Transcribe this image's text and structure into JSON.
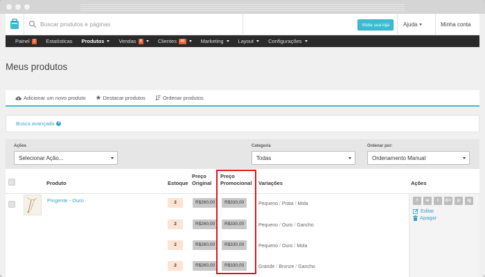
{
  "search": {
    "placeholder": "Buscar produtos e páginas"
  },
  "topbar": {
    "visit_label": "Visite sua loja",
    "help_label": "Ajuda",
    "account_label": "Minha conta"
  },
  "nav": {
    "painel": "Painel",
    "painel_badge": "2",
    "estatisticas": "Estatísticas",
    "produtos": "Produtos",
    "vendas": "Vendas",
    "vendas_badge": "8",
    "clientes": "Clientes",
    "clientes_badge": "45",
    "marketing": "Marketing",
    "layout": "Layout",
    "configuracoes": "Configurações"
  },
  "page": {
    "title": "Meus produtos"
  },
  "actions": {
    "add": "Adicionar um novo produto",
    "highlight": "Destacar produtos",
    "order": "Ordenar produtos"
  },
  "advanced_search": "Busca avançada",
  "filters": {
    "acoes_label": "Ações",
    "acoes_value": "Selecionar Ação...",
    "categoria_label": "Categoria",
    "categoria_value": "Todas",
    "ordenar_label": "Ordenar por:",
    "ordenar_value": "Ordenamento Manual"
  },
  "table": {
    "headers": {
      "produto": "Produto",
      "estoque": "Estoque",
      "preco_original_1": "Preço",
      "preco_original_2": "Original",
      "preco_promo_1": "Preço",
      "preco_promo_2": "Promocional",
      "variacoes": "Variações",
      "acoes": "Ações"
    },
    "product_name": "Pingente - Ouro",
    "rows": [
      {
        "estoque": "2",
        "original": "R$260,00",
        "promo": "R$330,00",
        "v1": "Pequeno",
        "v2": "Prata",
        "v3": "Mola"
      },
      {
        "estoque": "2",
        "original": "R$260,00",
        "promo": "R$330,00",
        "v1": "Pequeno",
        "v2": "Ouro",
        "v3": "Gancho"
      },
      {
        "estoque": "2",
        "original": "R$260,00",
        "promo": "R$330,00",
        "v1": "Pequeno",
        "v2": "Ouro",
        "v3": "Mola"
      },
      {
        "estoque": "2",
        "original": "R$260,00",
        "promo": "R$330,00",
        "v1": "Grande",
        "v2": "Bronze",
        "v3": "Gancho"
      }
    ],
    "edit_label": "Editar",
    "delete_label": "Apagar",
    "social": [
      "f",
      "w",
      "t",
      "G+",
      "p",
      "ig"
    ]
  },
  "colors": {
    "accent": "#3cbcd1",
    "link": "#3a9fc8",
    "nav_bg": "#2a2a2a",
    "badge": "#e8612c",
    "highlight": "#d9151c"
  }
}
